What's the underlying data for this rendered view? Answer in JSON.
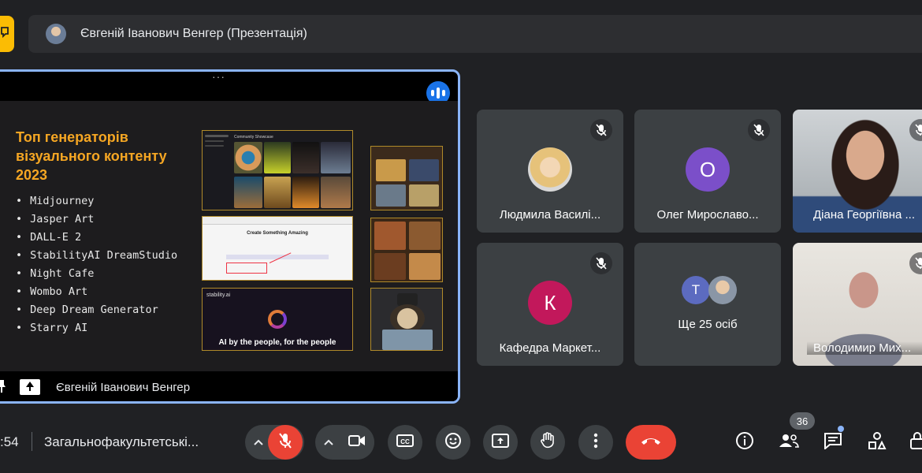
{
  "top": {
    "presenter_title": "Євгеній Іванович Венгер (Презентація)"
  },
  "presentation": {
    "slide_title": "Топ генераторів візуального контенту 2023",
    "slide_items": [
      "Midjourney",
      "Jasper Art",
      "DALL-E 2",
      "StabilityAI DreamStudio",
      "Night Cafe",
      "Wombo Art",
      "Deep Dream Generator",
      "Starry AI"
    ],
    "screenshot_texts": {
      "community": "Community Showcase",
      "create": "Create Something Amazing",
      "stability_logo": "stability.ai",
      "stability_tagline": "AI by the people, for the people"
    },
    "presenter_name": "Євгеній Іванович Венгер"
  },
  "participants": [
    {
      "name": "Людмила Василі...",
      "initial": "",
      "muted": true
    },
    {
      "name": "Олег Мирославо...",
      "initial": "О",
      "color": "#7b4fc9",
      "muted": true
    },
    {
      "name": "Діана Георгіївна ...",
      "initial": "",
      "muted": true
    },
    {
      "name": "Кафедра Маркет...",
      "initial": "К",
      "color": "#c2185b",
      "muted": true
    },
    {
      "name": "Ще 25 осіб",
      "initial": "Т",
      "color": "#5c6bc0"
    },
    {
      "name": "Володимир Мих...",
      "initial": "",
      "muted": true
    }
  ],
  "bottom": {
    "time": ":54",
    "meeting_name": "Загальнофакультетські...",
    "people_count": "36",
    "colors": {
      "end_call": "#ea4335",
      "mic_muted": "#ea4335"
    }
  },
  "icons": [
    "hand-raise-icon",
    "mic-off-icon",
    "chevron-up-icon",
    "camera-icon",
    "captions-icon",
    "emoji-icon",
    "present-icon",
    "raise-hand-icon",
    "more-vert-icon",
    "end-call-icon",
    "info-icon",
    "people-icon",
    "chat-icon",
    "activities-icon",
    "lock-icon"
  ]
}
